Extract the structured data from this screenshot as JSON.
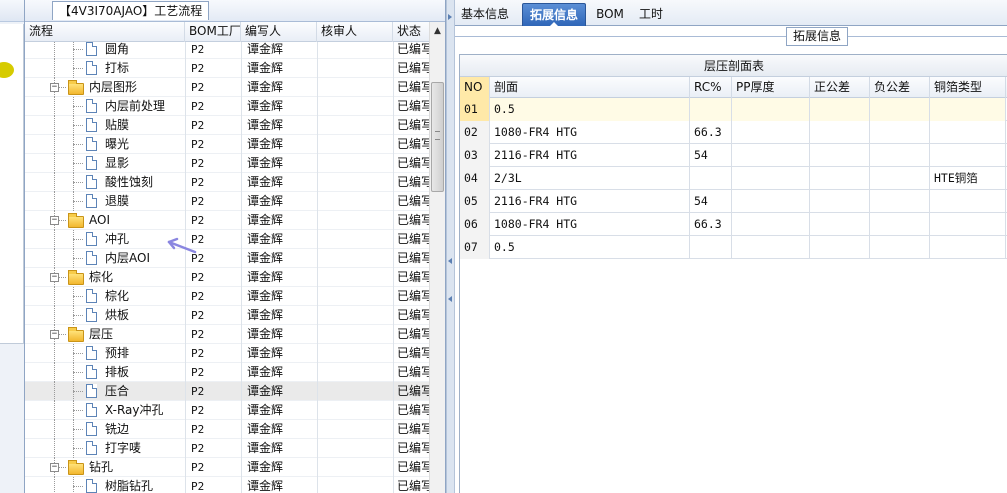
{
  "left_panel": {
    "title": "【4V3I70AJAO】工艺流程",
    "columns": [
      "流程",
      "BOM工厂",
      "编写人",
      "核审人",
      "状态"
    ],
    "rows": [
      {
        "name": "圆角",
        "type": "doc",
        "level": 2,
        "bom": "P2",
        "writer": "谭金辉",
        "status": "已编写"
      },
      {
        "name": "打标",
        "type": "doc",
        "level": 2,
        "bom": "P2",
        "writer": "谭金辉",
        "status": "已编写"
      },
      {
        "name": "内层图形",
        "type": "folder",
        "level": 1,
        "bom": "P2",
        "writer": "谭金辉",
        "status": "已编写"
      },
      {
        "name": "内层前处理",
        "type": "doc",
        "level": 2,
        "bom": "P2",
        "writer": "谭金辉",
        "status": "已编写"
      },
      {
        "name": "贴膜",
        "type": "doc",
        "level": 2,
        "bom": "P2",
        "writer": "谭金辉",
        "status": "已编写"
      },
      {
        "name": "曝光",
        "type": "doc",
        "level": 2,
        "bom": "P2",
        "writer": "谭金辉",
        "status": "已编写"
      },
      {
        "name": "显影",
        "type": "doc",
        "level": 2,
        "bom": "P2",
        "writer": "谭金辉",
        "status": "已编写"
      },
      {
        "name": "酸性蚀刻",
        "type": "doc",
        "level": 2,
        "bom": "P2",
        "writer": "谭金辉",
        "status": "已编写"
      },
      {
        "name": "退膜",
        "type": "doc",
        "level": 2,
        "bom": "P2",
        "writer": "谭金辉",
        "status": "已编写"
      },
      {
        "name": "AOI",
        "type": "folder",
        "level": 1,
        "bom": "P2",
        "writer": "谭金辉",
        "status": "已编写"
      },
      {
        "name": "冲孔",
        "type": "doc",
        "level": 2,
        "bom": "P2",
        "writer": "谭金辉",
        "status": "已编写"
      },
      {
        "name": "内层AOI",
        "type": "doc",
        "level": 2,
        "bom": "P2",
        "writer": "谭金辉",
        "status": "已编写"
      },
      {
        "name": "棕化",
        "type": "folder",
        "level": 1,
        "bom": "P2",
        "writer": "谭金辉",
        "status": "已编写"
      },
      {
        "name": "棕化",
        "type": "doc",
        "level": 2,
        "bom": "P2",
        "writer": "谭金辉",
        "status": "已编写"
      },
      {
        "name": "烘板",
        "type": "doc",
        "level": 2,
        "bom": "P2",
        "writer": "谭金辉",
        "status": "已编写"
      },
      {
        "name": "层压",
        "type": "folder",
        "level": 1,
        "bom": "P2",
        "writer": "谭金辉",
        "status": "已编写"
      },
      {
        "name": "预排",
        "type": "doc",
        "level": 2,
        "bom": "P2",
        "writer": "谭金辉",
        "status": "已编写"
      },
      {
        "name": "排板",
        "type": "doc",
        "level": 2,
        "bom": "P2",
        "writer": "谭金辉",
        "status": "已编写"
      },
      {
        "name": "压合",
        "type": "doc",
        "level": 2,
        "bom": "P2",
        "writer": "谭金辉",
        "status": "已编写",
        "selected": true
      },
      {
        "name": "X-Ray冲孔",
        "type": "doc",
        "level": 2,
        "bom": "P2",
        "writer": "谭金辉",
        "status": "已编写"
      },
      {
        "name": "铣边",
        "type": "doc",
        "level": 2,
        "bom": "P2",
        "writer": "谭金辉",
        "status": "已编写"
      },
      {
        "name": "打字唛",
        "type": "doc",
        "level": 2,
        "bom": "P2",
        "writer": "谭金辉",
        "status": "已编写"
      },
      {
        "name": "钻孔",
        "type": "folder",
        "level": 1,
        "bom": "P2",
        "writer": "谭金辉",
        "status": "已编写"
      },
      {
        "name": "树脂钻孔",
        "type": "doc",
        "level": 2,
        "bom": "P2",
        "writer": "谭金辉",
        "status": "已编写"
      }
    ]
  },
  "tabs": [
    {
      "label": "基本信息",
      "active": false
    },
    {
      "label": "拓展信息",
      "active": true
    },
    {
      "label": "BOM",
      "active": false
    },
    {
      "label": "工时",
      "active": false
    }
  ],
  "group_label": "拓展信息",
  "table": {
    "caption": "层压剖面表",
    "columns": [
      "NO",
      "剖面",
      "RC%",
      "PP厚度",
      "正公差",
      "负公差",
      "铜箔类型"
    ],
    "rows": [
      [
        "01",
        "0.5",
        "",
        "",
        "",
        "",
        ""
      ],
      [
        "02",
        "1080-FR4 HTG",
        "66.3",
        "",
        "",
        "",
        ""
      ],
      [
        "03",
        "2116-FR4 HTG",
        "54",
        "",
        "",
        "",
        ""
      ],
      [
        "04",
        "2/3L",
        "",
        "",
        "",
        "",
        "HTE铜箔"
      ],
      [
        "05",
        "2116-FR4 HTG",
        "54",
        "",
        "",
        "",
        ""
      ],
      [
        "06",
        "1080-FR4 HTG",
        "66.3",
        "",
        "",
        "",
        ""
      ],
      [
        "07",
        "0.5",
        "",
        "",
        "",
        "",
        ""
      ]
    ]
  },
  "colors": {
    "active_tab": "#2f66b8",
    "selected_row": "#eaeaea",
    "no_header": "#ffe9a8",
    "folder": "#f2b72e",
    "arrow_annotation": "#8a86e0"
  }
}
